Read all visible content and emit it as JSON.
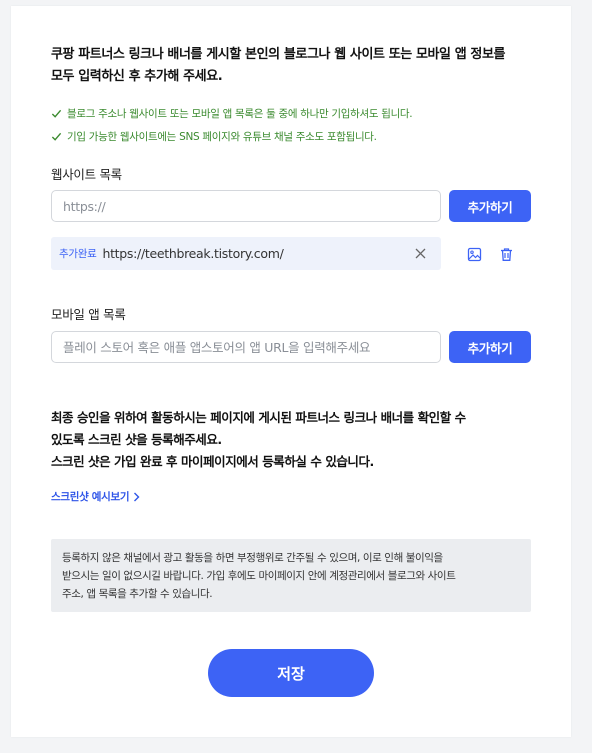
{
  "intro": {
    "line1": "쿠팡 파트너스 링크나 배너를 게시할 본인의 블로그나 웹 사이트 또는 모바일 앱 정보를",
    "line2": "모두 입력하신 후 추가해 주세요."
  },
  "checks": [
    "블로그 주소나 웹사이트 또는 모바일 앱 목록은 둘 중에 하나만 기입하셔도 됩니다.",
    "기입 가능한 웹사이트에는 SNS 페이지와 유튜브 채널 주소도 포함됩니다."
  ],
  "website": {
    "label": "웹사이트 목록",
    "placeholder": "https://",
    "add_label": "추가하기",
    "added": [
      {
        "badge": "추가완료",
        "url": "https://teethbreak.tistory.com/"
      }
    ]
  },
  "mobile": {
    "label": "모바일 앱 목록",
    "placeholder": "플레이 스토어 혹은 애플 앱스토어의 앱 URL을 입력해주세요",
    "add_label": "추가하기"
  },
  "notice": {
    "line1": "최종 승인을 위하여 활동하시는 페이지에 게시된 파트너스 링크나 배너를 확인할 수",
    "line2": "있도록 스크린 샷을 등록해주세요.",
    "line3": "스크린 샷은 가입 완료 후 마이페이지에서 등록하실 수 있습니다."
  },
  "example_link": "스크린샷 예시보기",
  "warning": {
    "line1": "등록하지 않은 채널에서 광고 활동을 하면 부정행위로 간주될 수 있으며, 이로 인해 불이익을",
    "line2": "받으시는 일이 없으시길 바랍니다. 가입 후에도 마이페이지 안에 계정관리에서 블로그와 사이트",
    "line3": "주소, 앱 목록을 추가할 수 있습니다."
  },
  "save_label": "저장",
  "colors": {
    "accent": "#3d63f5",
    "check_green": "#3a8a2e",
    "added_row_bg": "#eef2fb",
    "warning_bg": "#ebedf0"
  },
  "icons": {
    "check": "check-icon",
    "remove": "close-icon",
    "image": "image-icon",
    "trash": "trash-icon",
    "chevron": "chevron-right-icon"
  }
}
